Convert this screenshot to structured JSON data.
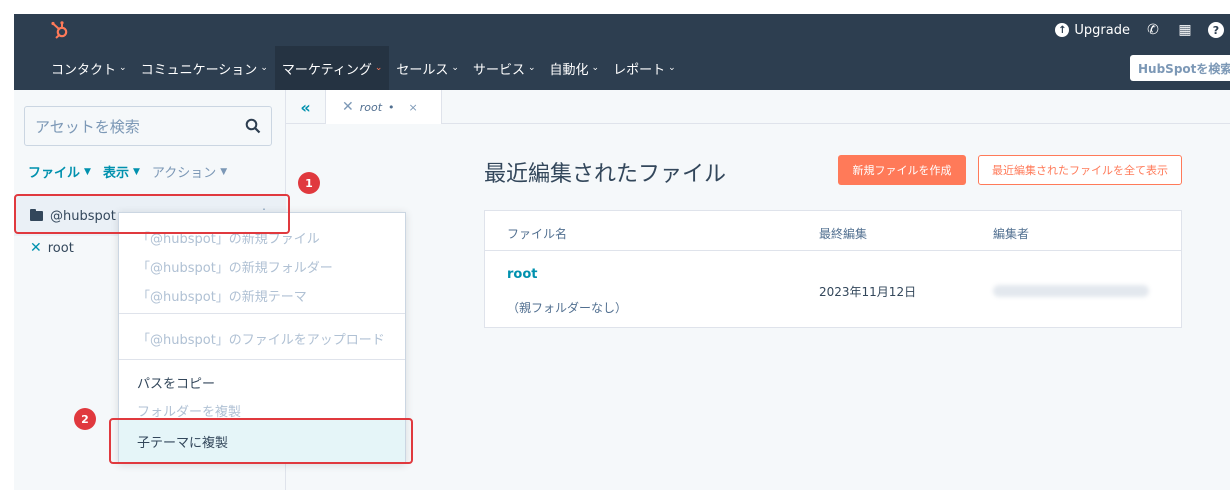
{
  "topbar": {
    "upgrade_label": "Upgrade",
    "help_label": "?"
  },
  "nav": {
    "items": [
      {
        "label": "コンタクト"
      },
      {
        "label": "コミュニケーション"
      },
      {
        "label": "マーケティング"
      },
      {
        "label": "セールス"
      },
      {
        "label": "サービス"
      },
      {
        "label": "自動化"
      },
      {
        "label": "レポート"
      }
    ],
    "search_placeholder": "HubSpotを検索"
  },
  "sidebar": {
    "search_placeholder": "アセットを検索",
    "filters": {
      "file": "ファイル",
      "view": "表示",
      "action": "アクション"
    },
    "tree": {
      "hubspot": "@hubspot",
      "root": "root"
    }
  },
  "context_menu": {
    "items": [
      "「@hubspot」の新規ファイル",
      "「@hubspot」の新規フォルダー",
      "「@hubspot」の新規テーマ",
      "「@hubspot」のファイルをアップロード",
      "パスをコピー",
      "フォルダーを複製",
      "子テーマに複製"
    ]
  },
  "tabs": {
    "collapse_label": "«",
    "active": "root",
    "active_suffix": "•",
    "close_label": "×"
  },
  "main": {
    "title": "最近編集されたファイル",
    "new_file_button": "新規ファイルを作成",
    "view_all_button": "最近編集されたファイルを全て表示",
    "table": {
      "headers": [
        "ファイル名",
        "最終編集",
        "編集者"
      ],
      "rows": [
        {
          "name": "root",
          "parent": "（親フォルダーなし）",
          "date": "2023年11月12日"
        }
      ]
    }
  },
  "annotations": {
    "badge_1": "1",
    "badge_2": "2",
    "accent": "#e0393e"
  }
}
